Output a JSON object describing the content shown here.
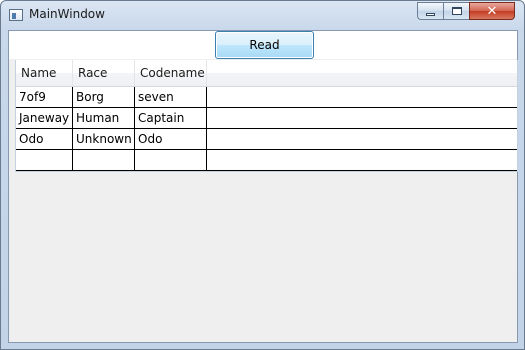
{
  "window": {
    "title": "MainWindow",
    "controls": {
      "minimize_glyph": "",
      "maximize_glyph": "",
      "close_glyph": "✕"
    }
  },
  "toolbar": {
    "read_label": "Read"
  },
  "grid": {
    "columns": [
      "Name",
      "Race",
      "Codename",
      ""
    ],
    "rows": [
      [
        "7of9",
        "Borg",
        "seven",
        ""
      ],
      [
        "Janeway",
        "Human",
        "Captain",
        ""
      ],
      [
        "Odo",
        "Unknown",
        "Odo",
        ""
      ],
      [
        "",
        "",
        "",
        ""
      ]
    ]
  },
  "colors": {
    "button_border": "#3c7fb1",
    "client_background": "#efefef",
    "close_button": "#c43b23"
  }
}
